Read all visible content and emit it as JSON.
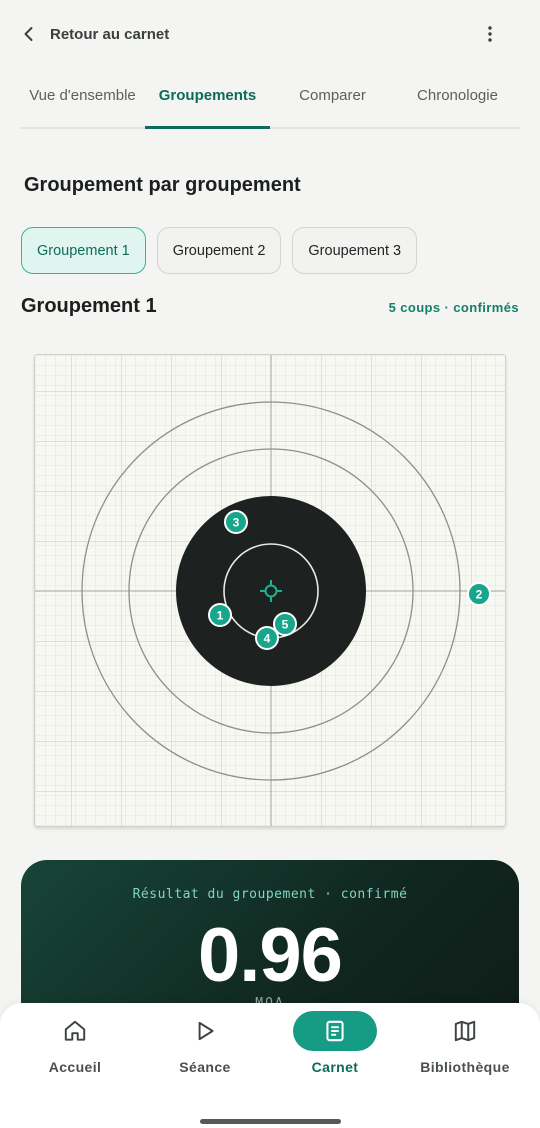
{
  "header": {
    "back_label": "Retour au carnet"
  },
  "tabs": [
    {
      "label": "Vue d'ensemble",
      "active": false
    },
    {
      "label": "Groupements",
      "active": true
    },
    {
      "label": "Comparer",
      "active": false
    },
    {
      "label": "Chronologie",
      "active": false
    }
  ],
  "section": {
    "title": "Groupement par groupement"
  },
  "chips": [
    {
      "label": "Groupement 1",
      "active": true
    },
    {
      "label": "Groupement 2",
      "active": false
    },
    {
      "label": "Groupement 3",
      "active": false
    }
  ],
  "group": {
    "title": "Groupement 1",
    "status": "5 coups · confirmés"
  },
  "shots": [
    {
      "label": "1"
    },
    {
      "label": "2"
    },
    {
      "label": "3"
    },
    {
      "label": "4"
    },
    {
      "label": "5"
    }
  ],
  "result": {
    "label": "Résultat du groupement · confirmé",
    "value": "0.96",
    "unit": "MOA"
  },
  "nav": [
    {
      "label": "Accueil",
      "icon": "home-icon",
      "active": false
    },
    {
      "label": "Séance",
      "icon": "play-icon",
      "active": false
    },
    {
      "label": "Carnet",
      "icon": "notebook-icon",
      "active": true
    },
    {
      "label": "Bibliothèque",
      "icon": "map-icon",
      "active": false
    }
  ],
  "colors": {
    "accent": "#0d6b5a",
    "accent_bright": "#169c84",
    "shot_marker": "#17a58c",
    "target_black": "#1d2220",
    "result_card": "#10261f"
  }
}
